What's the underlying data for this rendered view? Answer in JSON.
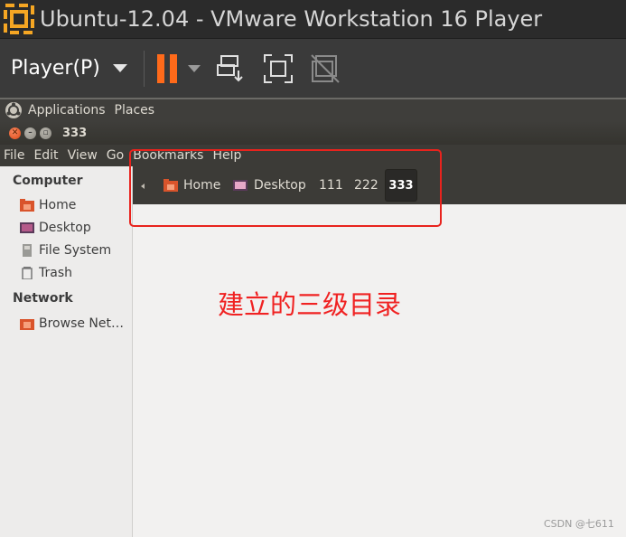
{
  "vmware": {
    "title": "Ubuntu-12.04 - VMware Workstation 16 Player",
    "player_menu": "Player(P)",
    "accent_color": "#ff6a1a",
    "icons": [
      "vmware-logo-icon",
      "pause-icon",
      "send-ctrl-alt-del-icon",
      "fullscreen-icon",
      "unity-icon"
    ]
  },
  "ubuntu_panel": {
    "menus": [
      "Applications",
      "Places"
    ],
    "icon": "ubuntu-logo-icon"
  },
  "window": {
    "title": "333",
    "buttons": [
      "close",
      "minimize",
      "maximize"
    ]
  },
  "menubar": {
    "file": "File",
    "edit": "Edit",
    "view": "View",
    "go": "Go",
    "bookmarks": "Bookmarks",
    "help": "Help"
  },
  "sidebar": {
    "computer_heading": "Computer",
    "home": "Home",
    "desktop": "Desktop",
    "file_system": "File System",
    "trash": "Trash",
    "network_heading": "Network",
    "browse_network": "Browse Net…"
  },
  "pathbar": {
    "home": "Home",
    "desktop": "Desktop",
    "dir1": "111",
    "dir2": "222",
    "current": "333"
  },
  "annotation": {
    "text": "建立的三级目录",
    "color": "#f02222"
  },
  "watermark": "CSDN @七611"
}
